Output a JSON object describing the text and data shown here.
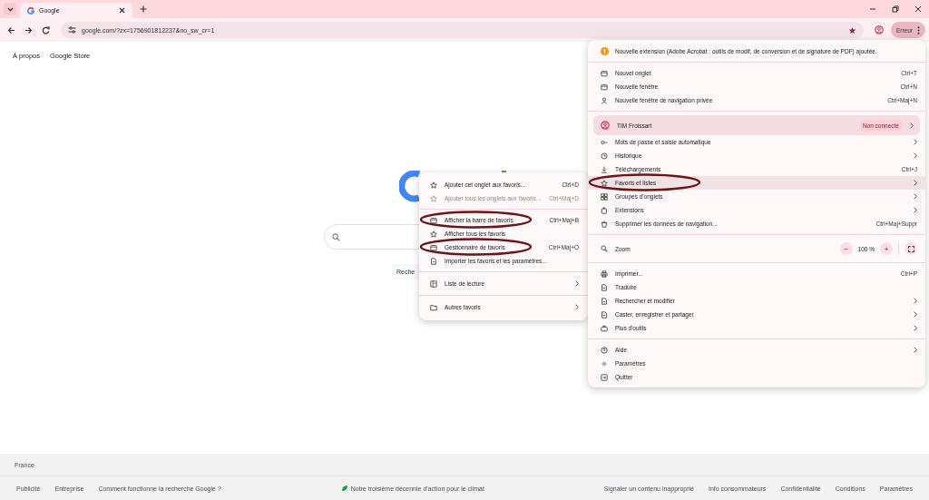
{
  "browser": {
    "tab": {
      "title": "Google"
    },
    "url": "google.com/?zx=1756901812237&no_sw_cr=1",
    "profile_button": "Erreur"
  },
  "page": {
    "top_links": [
      "À propos",
      "Google Store"
    ],
    "search_button": "Reche"
  },
  "main_menu": {
    "notice": "Nouvelle extension (Adobe Acrobat : outils de modif, de conversion et de signature de PDF) ajoutée.",
    "sections": [
      [
        {
          "kind": "item",
          "label": "Nouvel onglet",
          "shortcut": "Ctrl+T",
          "submenu": false,
          "selected": false,
          "annotated": false
        },
        {
          "kind": "item",
          "label": "Nouvelle fenêtre",
          "shortcut": "Ctrl+N",
          "submenu": false,
          "selected": false,
          "annotated": false
        },
        {
          "kind": "item",
          "label": "Nouvelle fenêtre de navigation privée",
          "shortcut": "Ctrl+Maj+N",
          "submenu": false,
          "selected": false,
          "annotated": false
        }
      ],
      [
        {
          "kind": "profile",
          "label": "TIM Froissart",
          "status": "Non connecté",
          "submenu": true,
          "selected": false
        },
        {
          "kind": "item",
          "label": "Mots de passe et saisie automatique",
          "submenu": true,
          "selected": false,
          "annotated": false
        },
        {
          "kind": "item",
          "label": "Historique",
          "submenu": true,
          "selected": false,
          "annotated": false
        },
        {
          "kind": "item",
          "label": "Téléchargements",
          "shortcut": "Ctrl+J",
          "submenu": false,
          "selected": false,
          "annotated": false
        },
        {
          "kind": "item",
          "label": "Favoris et listes",
          "submenu": true,
          "selected": true,
          "annotated": true
        },
        {
          "kind": "item",
          "label": "Groupes d'onglets",
          "submenu": true,
          "selected": false,
          "annotated": false
        },
        {
          "kind": "item",
          "label": "Extensions",
          "submenu": true,
          "selected": false,
          "annotated": false
        },
        {
          "kind": "item",
          "label": "Supprimer les données de navigation...",
          "shortcut": "Ctrl+Maj+Suppr",
          "submenu": false,
          "selected": false,
          "annotated": false
        }
      ],
      [
        {
          "kind": "zoom",
          "label": "Zoom",
          "minus": "−",
          "value": "100 %",
          "plus": "+",
          "selected": false
        }
      ],
      [
        {
          "kind": "item",
          "label": "Imprimer...",
          "shortcut": "Ctrl+P",
          "submenu": false,
          "selected": false,
          "annotated": false
        },
        {
          "kind": "item",
          "label": "Traduire",
          "submenu": false,
          "selected": false,
          "annotated": false
        },
        {
          "kind": "item",
          "label": "Rechercher et modifier",
          "submenu": true,
          "selected": false,
          "annotated": false
        },
        {
          "kind": "item",
          "label": "Caster, enregistrer et partager",
          "submenu": true,
          "selected": false,
          "annotated": false
        },
        {
          "kind": "item",
          "label": "Plus d'outils",
          "submenu": true,
          "selected": false,
          "annotated": false
        }
      ],
      [
        {
          "kind": "item",
          "label": "Aide",
          "submenu": true,
          "selected": false,
          "annotated": false
        },
        {
          "kind": "item",
          "label": "Paramètres",
          "submenu": false,
          "selected": false,
          "annotated": false
        },
        {
          "kind": "item",
          "label": "Quitter",
          "submenu": false,
          "selected": false,
          "annotated": false
        }
      ]
    ]
  },
  "bookmarks_submenu": {
    "sections": [
      [
        {
          "label": "Ajouter cet onglet aux favoris...",
          "shortcut": "Ctrl+D",
          "submenu": false,
          "disabled": false,
          "annotated": false
        },
        {
          "label": "Ajouter tous les onglets aux favoris...",
          "shortcut": "Ctrl+Maj+D",
          "submenu": false,
          "disabled": true,
          "annotated": false
        }
      ],
      [
        {
          "label": "Afficher la barre de favoris",
          "shortcut": "Ctrl+Maj+B",
          "submenu": false,
          "disabled": false,
          "annotated": true
        },
        {
          "label": "Afficher tous les favoris",
          "submenu": false,
          "disabled": false,
          "annotated": false
        },
        {
          "label": "Gestionnaire de favoris",
          "shortcut": "Ctrl+Maj+O",
          "submenu": false,
          "disabled": false,
          "annotated": true
        },
        {
          "label": "Importer les favoris et les paramètres...",
          "submenu": false,
          "disabled": false,
          "annotated": false
        }
      ],
      [
        {
          "label": "Liste de lecture",
          "submenu": true,
          "disabled": false,
          "annotated": false
        }
      ],
      [
        {
          "label": "Autres favoris",
          "submenu": true,
          "disabled": false,
          "annotated": false
        }
      ]
    ]
  },
  "footer": {
    "country": "France",
    "left_links": [
      "Publicité",
      "Entreprise",
      "Comment fonctionne la recherche Google ?"
    ],
    "climate_link": "Notre troisième décennie d'action pour le climat",
    "right_links": [
      "Signaler un contenu inapproprié",
      "Info consommateurs",
      "Confidentialité",
      "Conditions",
      "Paramètres"
    ]
  }
}
